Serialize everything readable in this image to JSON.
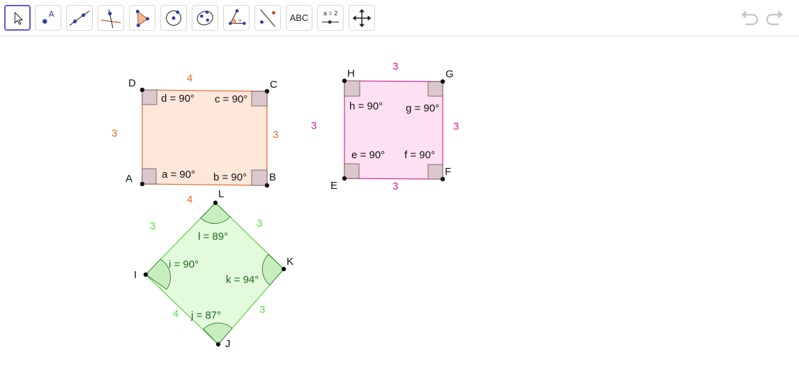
{
  "toolbar": {
    "tools": [
      {
        "name": "move",
        "icon": "cursor-arrow-icon",
        "selected": true
      },
      {
        "name": "point",
        "icon": "point-icon",
        "label": "A"
      },
      {
        "name": "line",
        "icon": "line-icon"
      },
      {
        "name": "perpendicular-line",
        "icon": "perpendicular-line-icon"
      },
      {
        "name": "polygon",
        "icon": "polygon-icon"
      },
      {
        "name": "circle",
        "icon": "circle-center-icon"
      },
      {
        "name": "ellipse",
        "icon": "ellipse-icon"
      },
      {
        "name": "angle",
        "icon": "angle-icon"
      },
      {
        "name": "reflect",
        "icon": "reflect-icon"
      },
      {
        "name": "text",
        "icon": "text-icon",
        "label": "ABC"
      },
      {
        "name": "slider",
        "icon": "slider-icon",
        "label": "a = 2"
      },
      {
        "name": "move-graphics-view",
        "icon": "move-view-icon"
      }
    ],
    "undo_icon": "undo-icon",
    "redo_icon": "redo-icon"
  },
  "colors": {
    "rect_fill": "#fde7db",
    "rect_stroke": "#e06a2a",
    "rect_label": "#e06a2a",
    "square_fill": "#fde0f1",
    "square_stroke": "#d4309a",
    "square_label": "#e0189a",
    "rhombus_fill": "#e3fadc",
    "rhombus_stroke": "#66cc44",
    "rhombus_label": "#55e044",
    "angle_text_dark_green": "#1a6b1a",
    "marker_fill": "#dcc8cc",
    "marker_stroke": "#555555",
    "selected_tool": "#6557d2"
  },
  "rectangle": {
    "vertices": {
      "A": "A",
      "B": "B",
      "C": "C",
      "D": "D"
    },
    "sides": {
      "top": "4",
      "bottom": "4",
      "left": "3",
      "right": "3"
    },
    "angles": {
      "a": "a = 90°",
      "b": "b = 90°",
      "c": "c = 90°",
      "d": "d = 90°"
    }
  },
  "square": {
    "vertices": {
      "E": "E",
      "F": "F",
      "G": "G",
      "H": "H"
    },
    "sides": {
      "top": "3",
      "bottom": "3",
      "left": "3",
      "right": "3"
    },
    "angles": {
      "e": "e = 90°",
      "f": "f = 90°",
      "g": "g = 90°",
      "h": "h = 90°"
    }
  },
  "rhombus": {
    "vertices": {
      "I": "I",
      "J": "J",
      "K": "K",
      "L": "L"
    },
    "sides": {
      "IL": "3",
      "LK": "3",
      "KJ": "3",
      "JI": "4"
    },
    "angles": {
      "i": "i = 90°",
      "j": "j = 87°",
      "k": "k = 94°",
      "l": "l = 89°"
    }
  }
}
